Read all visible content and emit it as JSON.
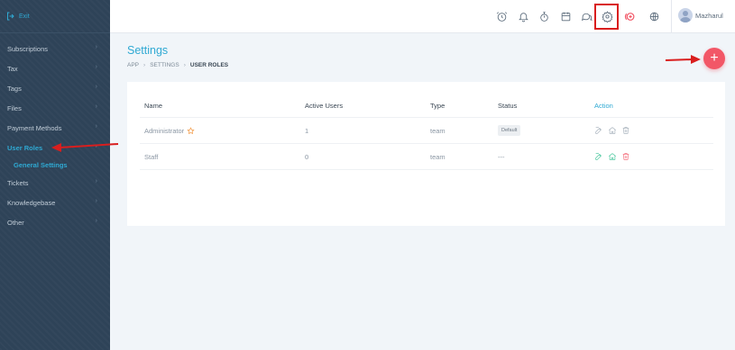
{
  "sidebar": {
    "exit_label": "Exit",
    "items": [
      {
        "label": "Subscriptions"
      },
      {
        "label": "Tax"
      },
      {
        "label": "Tags"
      },
      {
        "label": "Files"
      },
      {
        "label": "Payment Methods"
      },
      {
        "label": "User Roles"
      },
      {
        "label": "Tickets"
      },
      {
        "label": "Knowledgebase"
      },
      {
        "label": "Other"
      }
    ],
    "sub_item": "General Settings"
  },
  "header": {
    "icons": [
      "alarm-clock-icon",
      "bell-icon",
      "stopwatch-icon",
      "calendar-icon",
      "chat-icon",
      "gear-icon",
      "add-circle-icon",
      "globe-icon"
    ],
    "user_name": "Mazharul"
  },
  "page": {
    "title": "Settings",
    "breadcrumb": [
      "APP",
      "SETTINGS",
      "USER ROLES"
    ],
    "add_button": "+"
  },
  "table": {
    "headers": {
      "name": "Name",
      "active_users": "Active Users",
      "type": "Type",
      "status": "Status",
      "action": "Action"
    },
    "rows": [
      {
        "name": "Administrator",
        "active_users": "1",
        "type": "team",
        "status": "Default"
      },
      {
        "name": "Staff",
        "active_users": "0",
        "type": "team",
        "status": "---"
      }
    ]
  },
  "colors": {
    "accent": "#2fa9d3",
    "sidebar": "#2e4358",
    "fab": "#f25767",
    "annotation": "#d91e1e"
  }
}
